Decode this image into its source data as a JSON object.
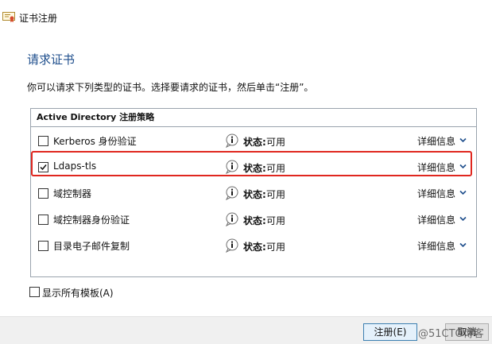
{
  "window": {
    "title": "证书注册"
  },
  "heading": "请求证书",
  "instruction": "你可以请求下列类型的证书。选择要请求的证书，然后单击“注册”。",
  "policy": {
    "header": "Active Directory 注册策略",
    "items": [
      {
        "label": "Kerberos 身份验证",
        "checked": false,
        "status_label": "状态:",
        "status_value": "可用",
        "details": "详细信息"
      },
      {
        "label": "Ldaps-tls",
        "checked": true,
        "status_label": "状态:",
        "status_value": "可用",
        "details": "详细信息"
      },
      {
        "label": "域控制器",
        "checked": false,
        "status_label": "状态:",
        "status_value": "可用",
        "details": "详细信息"
      },
      {
        "label": "域控制器身份验证",
        "checked": false,
        "status_label": "状态:",
        "status_value": "可用",
        "details": "详细信息"
      },
      {
        "label": "目录电子邮件复制",
        "checked": false,
        "status_label": "状态:",
        "status_value": "可用",
        "details": "详细信息"
      }
    ]
  },
  "show_all_templates": {
    "label": "显示所有模板(A)",
    "checked": false
  },
  "buttons": {
    "enroll": "注册(E)",
    "cancel": "取消"
  },
  "watermark": "@51CTO博客",
  "colors": {
    "heading": "#1e4e8c",
    "highlight": "#e0271f",
    "accent": "#3c7fb1"
  },
  "icons": {
    "title": "certificate-icon",
    "info": "info-icon",
    "details": "chevron-down-icon"
  }
}
